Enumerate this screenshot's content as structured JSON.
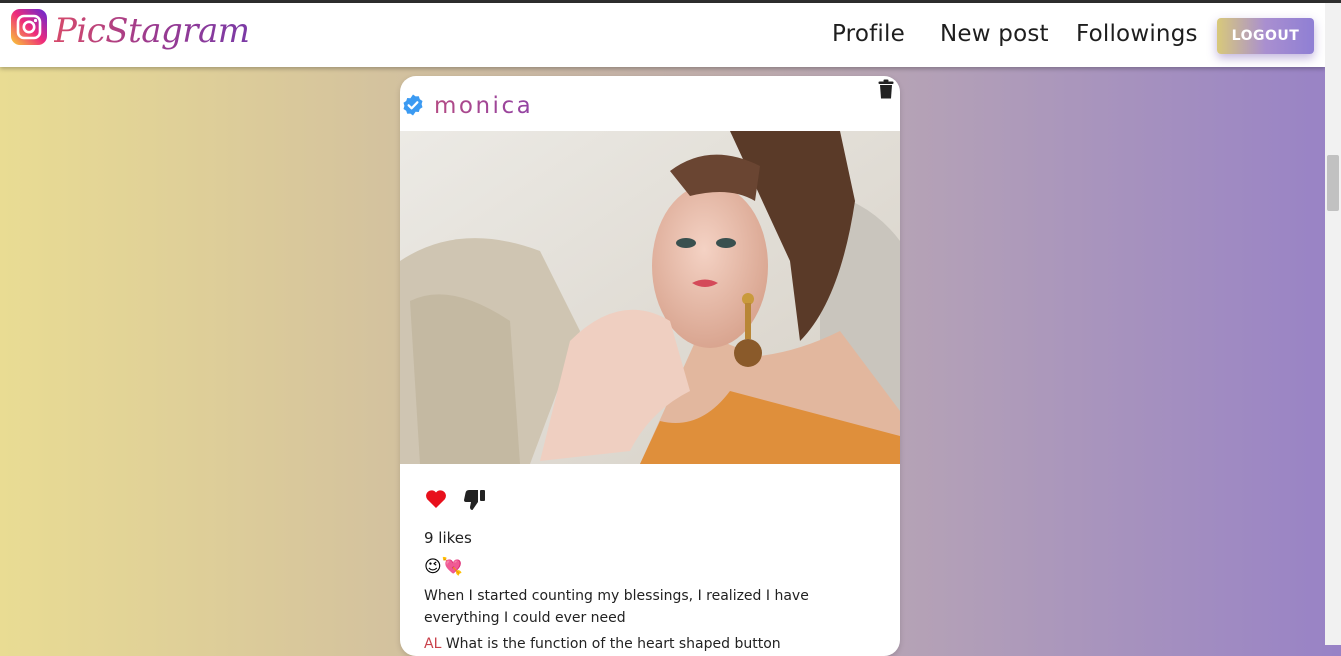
{
  "app": {
    "brand": "PicStagram"
  },
  "nav": {
    "links": [
      "Profile",
      "New post",
      "Followings"
    ],
    "logout_label": "LOGOUT"
  },
  "post": {
    "username": "monica",
    "likes_text": "9 likes",
    "emojis": "😉💘",
    "caption": "When I started counting my blessings, I realized I have everything I could ever need",
    "comment_preview_user": "AL  ",
    "comment_preview_text": "What is the function of the heart shaped button"
  },
  "colors": {
    "like": "#e8101c",
    "verified": "#3b9af2"
  }
}
